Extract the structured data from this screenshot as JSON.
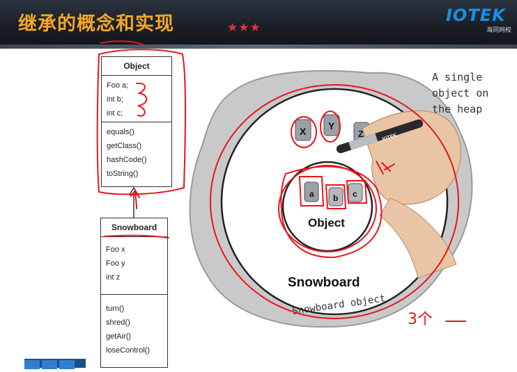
{
  "header": {
    "title": "继承的概念和实现",
    "stars": "★★★",
    "logo_text": "IOTEK",
    "logo_sub": "海同网校"
  },
  "uml": {
    "object_class": {
      "name": "Object",
      "fields": [
        "Foo a;",
        "int b;",
        "int c;"
      ],
      "methods": [
        "equals()",
        "getClass()",
        "hashCode()",
        "toString()"
      ]
    },
    "snowboard_class": {
      "name": "Snowboard",
      "fields": [
        "Foo x",
        "Foo y",
        "int z"
      ],
      "methods": [
        "turn()",
        "shred()",
        "getAir()",
        "loseControl()"
      ]
    }
  },
  "figure": {
    "note_lines": [
      "A single",
      "object on",
      "the heap"
    ],
    "outer_label": "Snowboard",
    "inner_label": "Object",
    "caption": "Snowboard object",
    "cups_outer": [
      "X",
      "Y",
      "Z"
    ],
    "cups_inner": [
      "a",
      "b",
      "c"
    ],
    "pen_brand": "IOTEK",
    "annotation_right": "3个"
  },
  "colors": {
    "title": "#f5a623",
    "stars": "#e8323c",
    "annotation": "#e8141c"
  }
}
